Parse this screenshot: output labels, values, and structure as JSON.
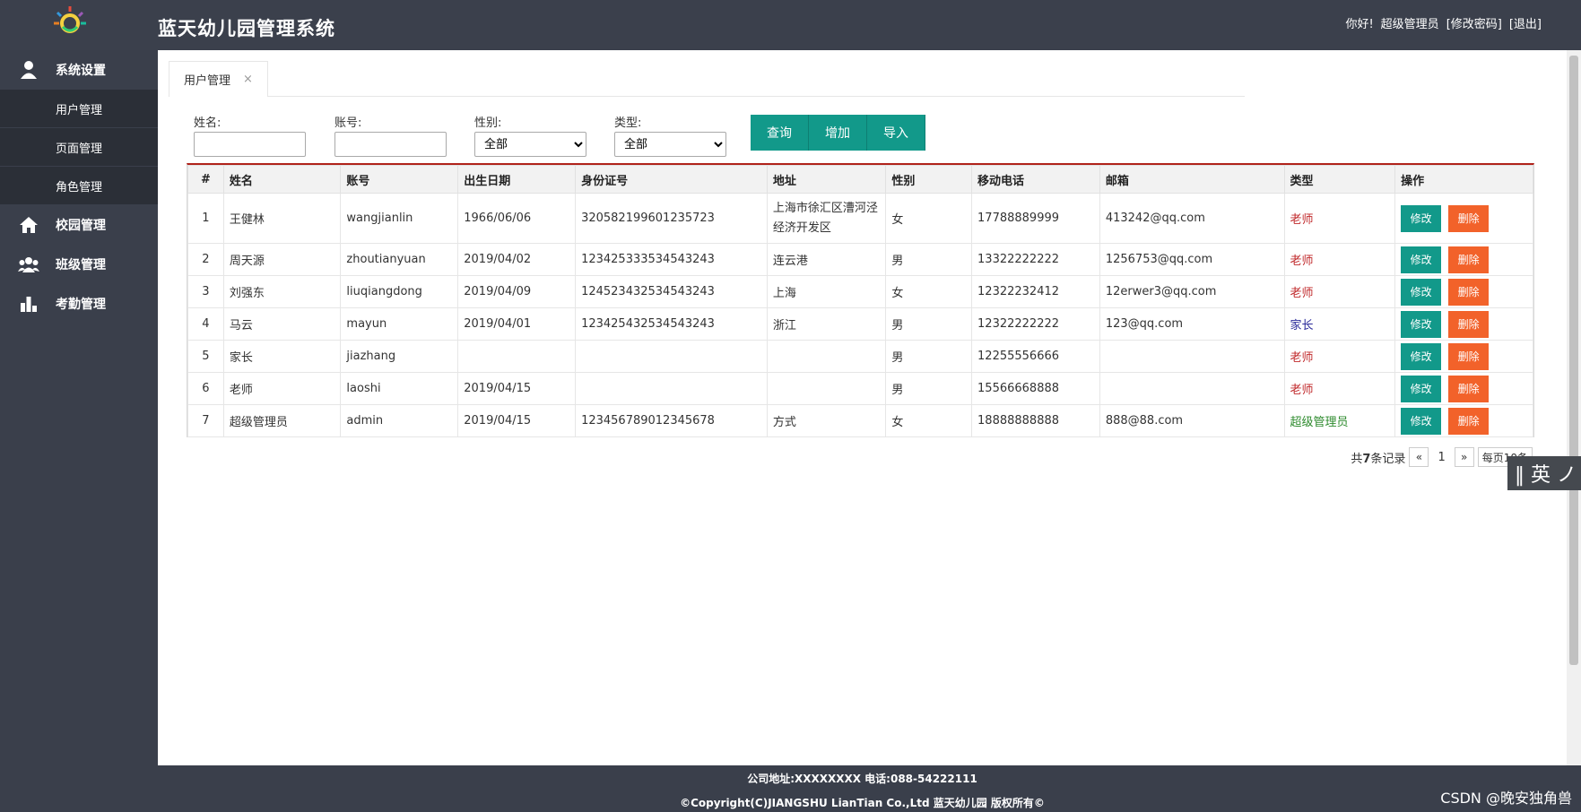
{
  "header": {
    "title": "蓝天幼儿园管理系统",
    "greeting": "你好!",
    "role": "超级管理员",
    "change_password": "[修改密码]",
    "logout": "[退出]"
  },
  "sidebar": {
    "groups": [
      {
        "label": "系统设置",
        "icon": "user-icon"
      },
      {
        "label": "校园管理",
        "icon": "home-icon"
      },
      {
        "label": "班级管理",
        "icon": "group-icon"
      },
      {
        "label": "考勤管理",
        "icon": "bar-chart-icon"
      }
    ],
    "sub_items": [
      "用户管理",
      "页面管理",
      "角色管理"
    ]
  },
  "tabs": [
    {
      "label": "用户管理",
      "close": "×"
    }
  ],
  "filters": {
    "name_label": "姓名:",
    "account_label": "账号:",
    "gender_label": "性别:",
    "gender_value": "全部",
    "type_label": "类型:",
    "type_value": "全部"
  },
  "buttons": {
    "query": "查询",
    "add": "增加",
    "import": "导入"
  },
  "table": {
    "headers": [
      "#",
      "姓名",
      "账号",
      "出生日期",
      "身份证号",
      "地址",
      "性别",
      "移动电话",
      "邮箱",
      "类型",
      "操作"
    ],
    "rows": [
      [
        "1",
        "王健林",
        "wangjianlin",
        "1966/06/06",
        "320582199601235723",
        "上海市徐汇区漕河泾经济开发区",
        "女",
        "17788889999",
        "413242@qq.com",
        "老师"
      ],
      [
        "2",
        "周天源",
        "zhoutianyuan",
        "2019/04/02",
        "123425333534543243",
        "连云港",
        "男",
        "13322222222",
        "1256753@qq.com",
        "老师"
      ],
      [
        "3",
        "刘强东",
        "liuqiangdong",
        "2019/04/09",
        "124523432534543243",
        "上海",
        "女",
        "12322232412",
        "12erwer3@qq.com",
        "老师"
      ],
      [
        "4",
        "马云",
        "mayun",
        "2019/04/01",
        "123425432534543243",
        "浙江",
        "男",
        "12322222222",
        "123@qq.com",
        "家长"
      ],
      [
        "5",
        "家长",
        "jiazhang",
        "",
        "",
        "",
        "男",
        "12255556666",
        "",
        "老师"
      ],
      [
        "6",
        "老师",
        "laoshi",
        "2019/04/15",
        "",
        "",
        "男",
        "15566668888",
        "",
        "老师"
      ],
      [
        "7",
        "超级管理员",
        "admin",
        "2019/04/15",
        "123456789012345678",
        "方式",
        "女",
        "18888888888",
        "888@88.com",
        "超级管理员"
      ]
    ],
    "edit_label": "修改",
    "delete_label": "删除"
  },
  "pager": {
    "summary_prefix": "共",
    "total": "7",
    "summary_suffix": "条记录",
    "prev": "«",
    "current": "1",
    "next": "»",
    "page_size": "每页10条"
  },
  "ime": {
    "label": "‖ 英 ノ"
  },
  "footer": {
    "address": "公司地址:XXXXXXXX 电话:088-54222111",
    "copyright": "©Copyright(C)JIANGSHU LianTian Co.,Ltd 蓝天幼儿园 版权所有©"
  },
  "watermark": "CSDN @晚安独角兽",
  "colors": {
    "accent": "#12998a",
    "danger": "#f2622a",
    "header_bg": "#3b404c",
    "table_top": "#b0221a"
  }
}
